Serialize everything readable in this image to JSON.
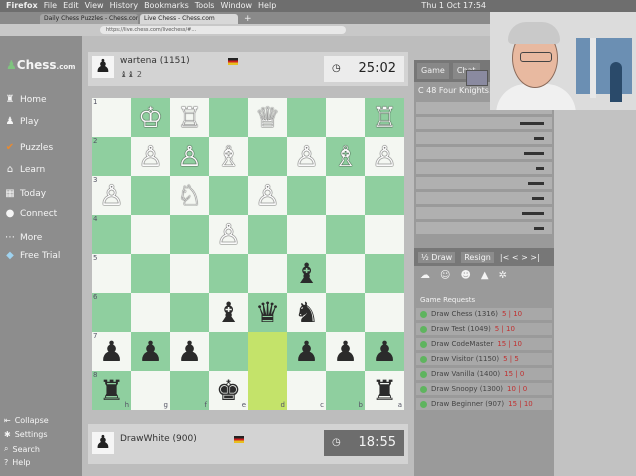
{
  "menubar": {
    "items": [
      "Firefox",
      "File",
      "Edit",
      "View",
      "History",
      "Bookmarks",
      "Tools",
      "Window",
      "Help"
    ],
    "clock": "Thu 1 Oct 17:54"
  },
  "browser": {
    "tabs": [
      "Daily Chess Puzzles - Chess.com",
      "Live Chess - Chess.com"
    ],
    "new_tab": "+",
    "url": "https://live.chess.com/livechess/#..."
  },
  "sidebar": {
    "logo": "Chess",
    "logo_suffix": ".com",
    "items": [
      {
        "label": "Home",
        "icon": "home-icon"
      },
      {
        "label": "Play",
        "icon": "pawn-icon"
      },
      {
        "label": "Puzzles",
        "icon": "puzzle-icon"
      },
      {
        "label": "Learn",
        "icon": "learn-icon"
      },
      {
        "label": "Today",
        "icon": "news-icon"
      },
      {
        "label": "Connect",
        "icon": "connect-icon"
      },
      {
        "label": "More",
        "icon": "more-icon"
      },
      {
        "label": "Free Trial",
        "icon": "diamond-icon"
      }
    ],
    "footer": [
      {
        "label": "Collapse",
        "icon": "collapse-icon"
      },
      {
        "label": "Settings",
        "icon": "gear-icon"
      },
      {
        "label": "Search",
        "icon": "search-icon"
      },
      {
        "label": "Help",
        "icon": "help-icon"
      }
    ]
  },
  "opponent": {
    "name": "wartena (1151)",
    "sub": "♝♝ 2",
    "clock": "25:02"
  },
  "player": {
    "name": "DrawWhite (900)",
    "clock": "18:55"
  },
  "board": {
    "squares": [
      [
        "",
        "♔",
        "♖",
        "",
        "♕",
        "",
        "",
        "♖"
      ],
      [
        "",
        "♙",
        "♙",
        "♗",
        "",
        "♙",
        "♗",
        "♙"
      ],
      [
        "♙",
        "",
        "♘",
        "",
        "♙",
        "",
        "",
        ""
      ],
      [
        "",
        "",
        "",
        "♙",
        "",
        "",
        "",
        ""
      ],
      [
        "",
        "",
        "",
        "",
        "",
        "♝",
        "",
        ""
      ],
      [
        "",
        "",
        "",
        "♝",
        "♛",
        "♞",
        "",
        ""
      ],
      [
        "♟",
        "♟",
        "♟",
        "",
        "",
        "♟",
        "♟",
        "♟"
      ],
      [
        "♜",
        "",
        "",
        "♚",
        "",
        "",
        "",
        "♜"
      ]
    ],
    "highlight": [
      [
        6,
        4
      ],
      [
        7,
        4
      ]
    ],
    "ranks": [
      "1",
      "2",
      "3",
      "4",
      "5",
      "6",
      "7",
      "8"
    ],
    "files": [
      "h",
      "g",
      "f",
      "e",
      "d",
      "c",
      "b",
      "a"
    ]
  },
  "panel": {
    "tabs": [
      "Game",
      "Chat"
    ],
    "opening": "C 48 Four Knights...",
    "moves_count": 9,
    "actions": {
      "draw": "½ Draw",
      "resign": "Resign",
      "nav": "|< < > >|"
    },
    "requests_label": "Game Requests",
    "requests": [
      {
        "name": "Draw Chess (1316)",
        "rating": "5 | 10"
      },
      {
        "name": "Draw Test (1049)",
        "rating": "5 | 10"
      },
      {
        "name": "Draw CodeMaster",
        "rating": "15 | 10"
      },
      {
        "name": "Draw Visitor (1150)",
        "rating": "5 | 5"
      },
      {
        "name": "Draw Vanilla (1400)",
        "rating": "15 | 0"
      },
      {
        "name": "Draw Snoopy (1300)",
        "rating": "10 | 0"
      },
      {
        "name": "Draw Beginner (907)",
        "rating": "15 | 10"
      }
    ]
  }
}
